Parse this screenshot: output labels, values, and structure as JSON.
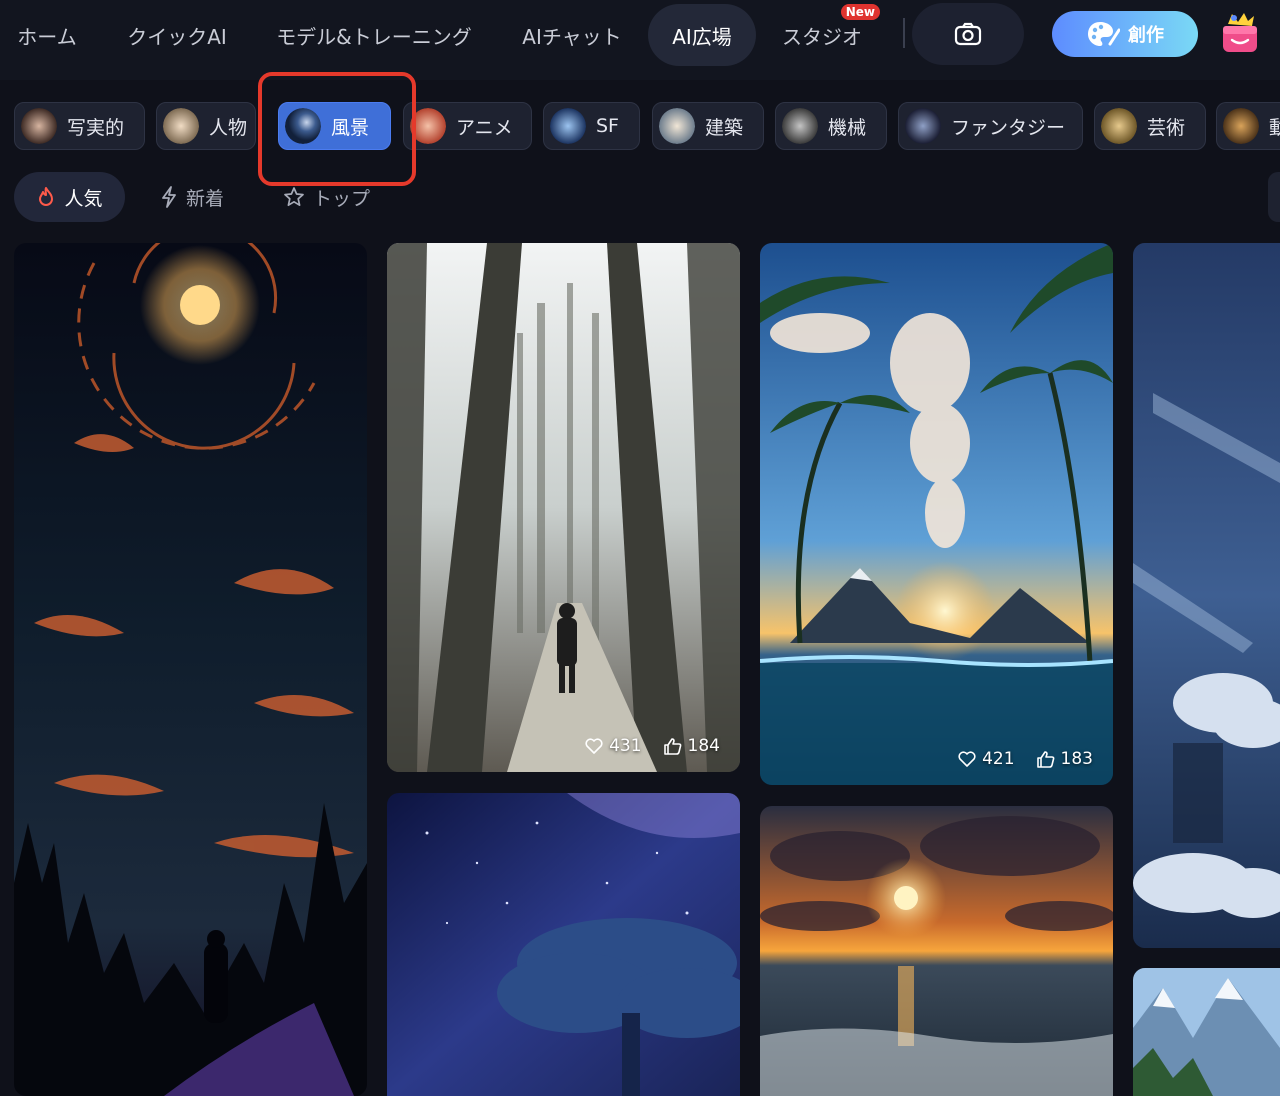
{
  "nav": {
    "items": [
      {
        "label": "ホーム"
      },
      {
        "label": "クイックAI"
      },
      {
        "label": "モデル&トレーニング"
      },
      {
        "label": "AIチャット"
      },
      {
        "label": "AI広場"
      },
      {
        "label": "スタジオ",
        "badge": "New"
      }
    ],
    "active_item": "AI広場",
    "create_label": "創作"
  },
  "categories": [
    {
      "label": "写実的"
    },
    {
      "label": "人物"
    },
    {
      "label": "風景"
    },
    {
      "label": "アニメ"
    },
    {
      "label": "SF"
    },
    {
      "label": "建築"
    },
    {
      "label": "機械"
    },
    {
      "label": "ファンタジー"
    },
    {
      "label": "芸術"
    },
    {
      "label": "動"
    }
  ],
  "selected_category": "風景",
  "sort_tabs": [
    {
      "label": "人気",
      "icon": "flame-icon"
    },
    {
      "label": "新着",
      "icon": "lightning-icon"
    },
    {
      "label": "トップ",
      "icon": "star-icon"
    }
  ],
  "selected_sort": "人気",
  "cards": [
    {
      "subject": "forest-path-hiker",
      "likes": "431",
      "thumbs": "184"
    },
    {
      "subject": "tropical-volcano-sunset",
      "likes": "421",
      "thumbs": "183"
    }
  ],
  "colors": {
    "background": "#0f111a",
    "accent_blue": "#3f6fd8",
    "highlight_red": "#e5392b",
    "new_badge": "#e0332f"
  }
}
